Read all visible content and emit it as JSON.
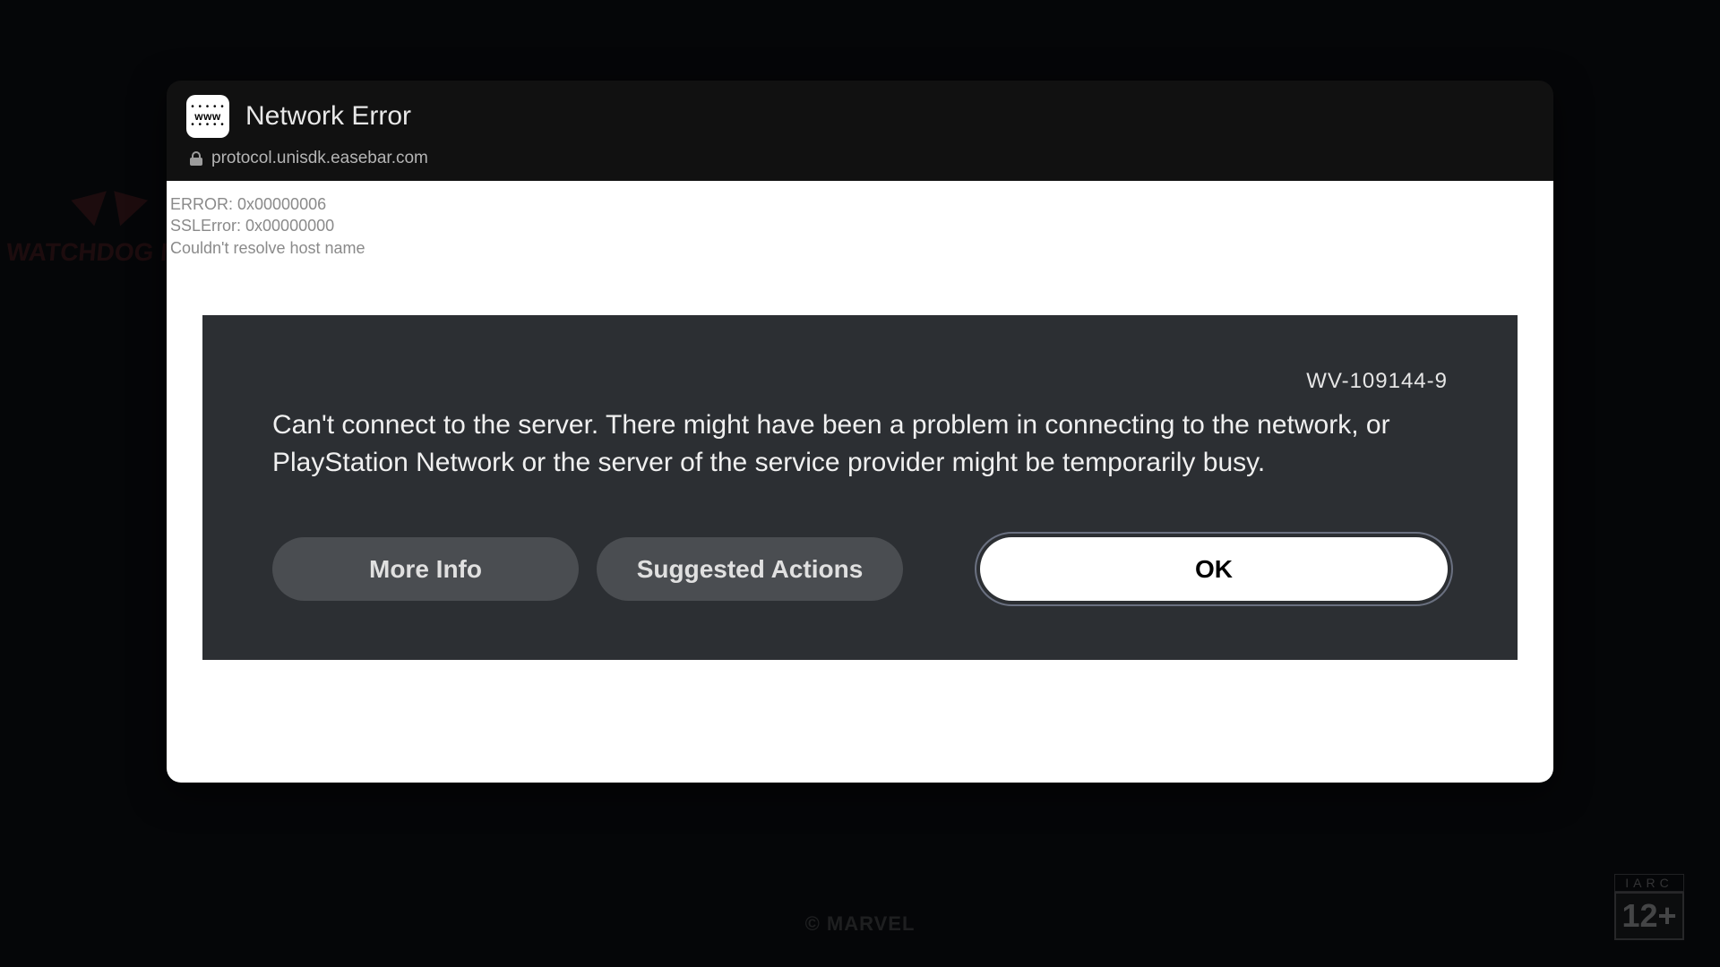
{
  "background": {
    "logo_left_text": "WATCHDOG INC",
    "brand_bottom": "© MARVEL",
    "rating": {
      "org": "IARC",
      "age": "12+"
    }
  },
  "modal": {
    "title": "Network Error",
    "icon_label": "www",
    "url": "protocol.unisdk.easebar.com",
    "error_lines": {
      "l1": "ERROR: 0x00000006",
      "l2": "SSLError: 0x00000000",
      "l3": "Couldn't resolve host name"
    }
  },
  "dialog": {
    "error_code": "WV-109144-9",
    "message": "Can't connect to the server. There might have been a problem in connecting to the network, or PlayStation Network or the server of the service provider might be temporarily busy.",
    "buttons": {
      "more_info": "More Info",
      "suggested": "Suggested Actions",
      "ok": "OK"
    }
  }
}
